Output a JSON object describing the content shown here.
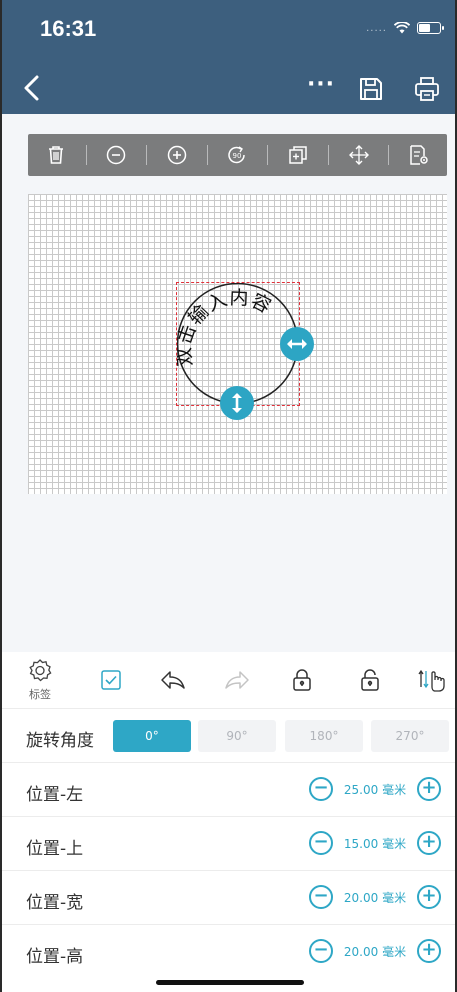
{
  "status_bar": {
    "time": "16:31",
    "signal": "....."
  },
  "toolbar_icons": [
    "trash-icon",
    "zoom-out-icon",
    "zoom-in-icon",
    "rotate-90-icon",
    "duplicate-icon",
    "move-icon",
    "properties-icon"
  ],
  "label": {
    "text": "双击输入内容"
  },
  "actions": {
    "settings_label": "标签"
  },
  "rotation": {
    "label": "旋转角度",
    "options": [
      "0°",
      "90°",
      "180°",
      "270°"
    ],
    "selected": "0°"
  },
  "position": {
    "left": {
      "label": "位置-左",
      "value": "25.00 毫米"
    },
    "top": {
      "label": "位置-上",
      "value": "15.00 毫米"
    },
    "width": {
      "label": "位置-宽",
      "value": "20.00 毫米"
    },
    "height": {
      "label": "位置-高",
      "value": "20.00 毫米"
    }
  },
  "colors": {
    "nav_bg": "#3d5f7e",
    "accent": "#2ea7c6",
    "selection": "#e0303a",
    "toolbar_bg": "#7b7c7d"
  }
}
